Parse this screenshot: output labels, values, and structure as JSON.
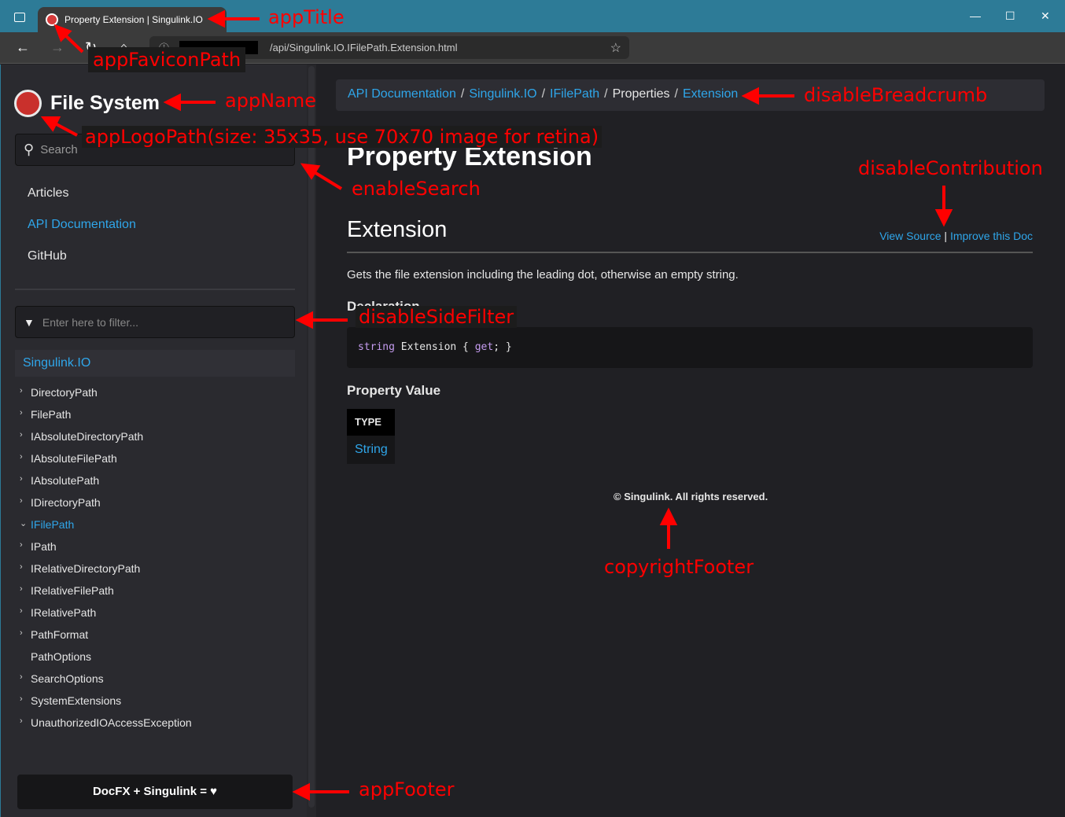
{
  "browser": {
    "tab_title": "Property Extension | Singulink.IO",
    "url": "/api/Singulink.IO.IFilePath.Extension.html"
  },
  "sidebar": {
    "app_name": "File System",
    "search_placeholder": "Search",
    "nav": [
      {
        "label": "Articles",
        "active": false
      },
      {
        "label": "API Documentation",
        "active": true
      },
      {
        "label": "GitHub",
        "active": false
      }
    ],
    "filter_placeholder": "Enter here to filter...",
    "package": "Singulink.IO",
    "tree": [
      {
        "label": "DirectoryPath",
        "chevron": "›"
      },
      {
        "label": "FilePath",
        "chevron": "›"
      },
      {
        "label": "IAbsoluteDirectoryPath",
        "chevron": "›"
      },
      {
        "label": "IAbsoluteFilePath",
        "chevron": "›"
      },
      {
        "label": "IAbsolutePath",
        "chevron": "›"
      },
      {
        "label": "IDirectoryPath",
        "chevron": "›"
      },
      {
        "label": "IFilePath",
        "chevron": "⌄",
        "active": true
      },
      {
        "label": "IPath",
        "chevron": "›"
      },
      {
        "label": "IRelativeDirectoryPath",
        "chevron": "›"
      },
      {
        "label": "IRelativeFilePath",
        "chevron": "›"
      },
      {
        "label": "IRelativePath",
        "chevron": "›"
      },
      {
        "label": "PathFormat",
        "chevron": "›"
      },
      {
        "label": "PathOptions",
        "chevron": ""
      },
      {
        "label": "SearchOptions",
        "chevron": "›"
      },
      {
        "label": "SystemExtensions",
        "chevron": "›"
      },
      {
        "label": "UnauthorizedIOAccessException",
        "chevron": "›"
      }
    ],
    "footer": "DocFX + Singulink = ♥"
  },
  "breadcrumb": [
    {
      "label": "API Documentation",
      "link": true
    },
    {
      "label": "Singulink.IO",
      "link": true
    },
    {
      "label": "IFilePath",
      "link": true
    },
    {
      "label": "Properties",
      "link": false
    },
    {
      "label": "Extension",
      "link": true
    }
  ],
  "main": {
    "title": "Property Extension",
    "subtitle": "Extension",
    "view_source": "View Source",
    "contrib_sep": "|",
    "improve": "Improve this Doc",
    "summary": "Gets the file extension including the leading dot, otherwise an empty string.",
    "declaration_heading": "Declaration",
    "code": {
      "kw1": "string",
      "name": " Extension { ",
      "kw2": "get",
      "end": "; }"
    },
    "property_value_heading": "Property Value",
    "type_header": "TYPE",
    "type_value": "String",
    "copyright": "© Singulink. All rights reserved."
  },
  "annotations": {
    "appTitle": "appTitle",
    "appFaviconPath": "appFaviconPath",
    "appName": "appName",
    "appLogoPath": "appLogoPath(size: 35x35, use 70x70 image for retina)",
    "enableSearch": "enableSearch",
    "disableBreadcrumb": "disableBreadcrumb",
    "disableContribution": "disableContribution",
    "disableSideFilter": "disableSideFilter",
    "copyrightFooter": "copyrightFooter",
    "appFooter": "appFooter"
  },
  "colors": {
    "link": "#2fa6ea",
    "titlebar": "#2d7b97",
    "annotation": "#ff0000"
  }
}
